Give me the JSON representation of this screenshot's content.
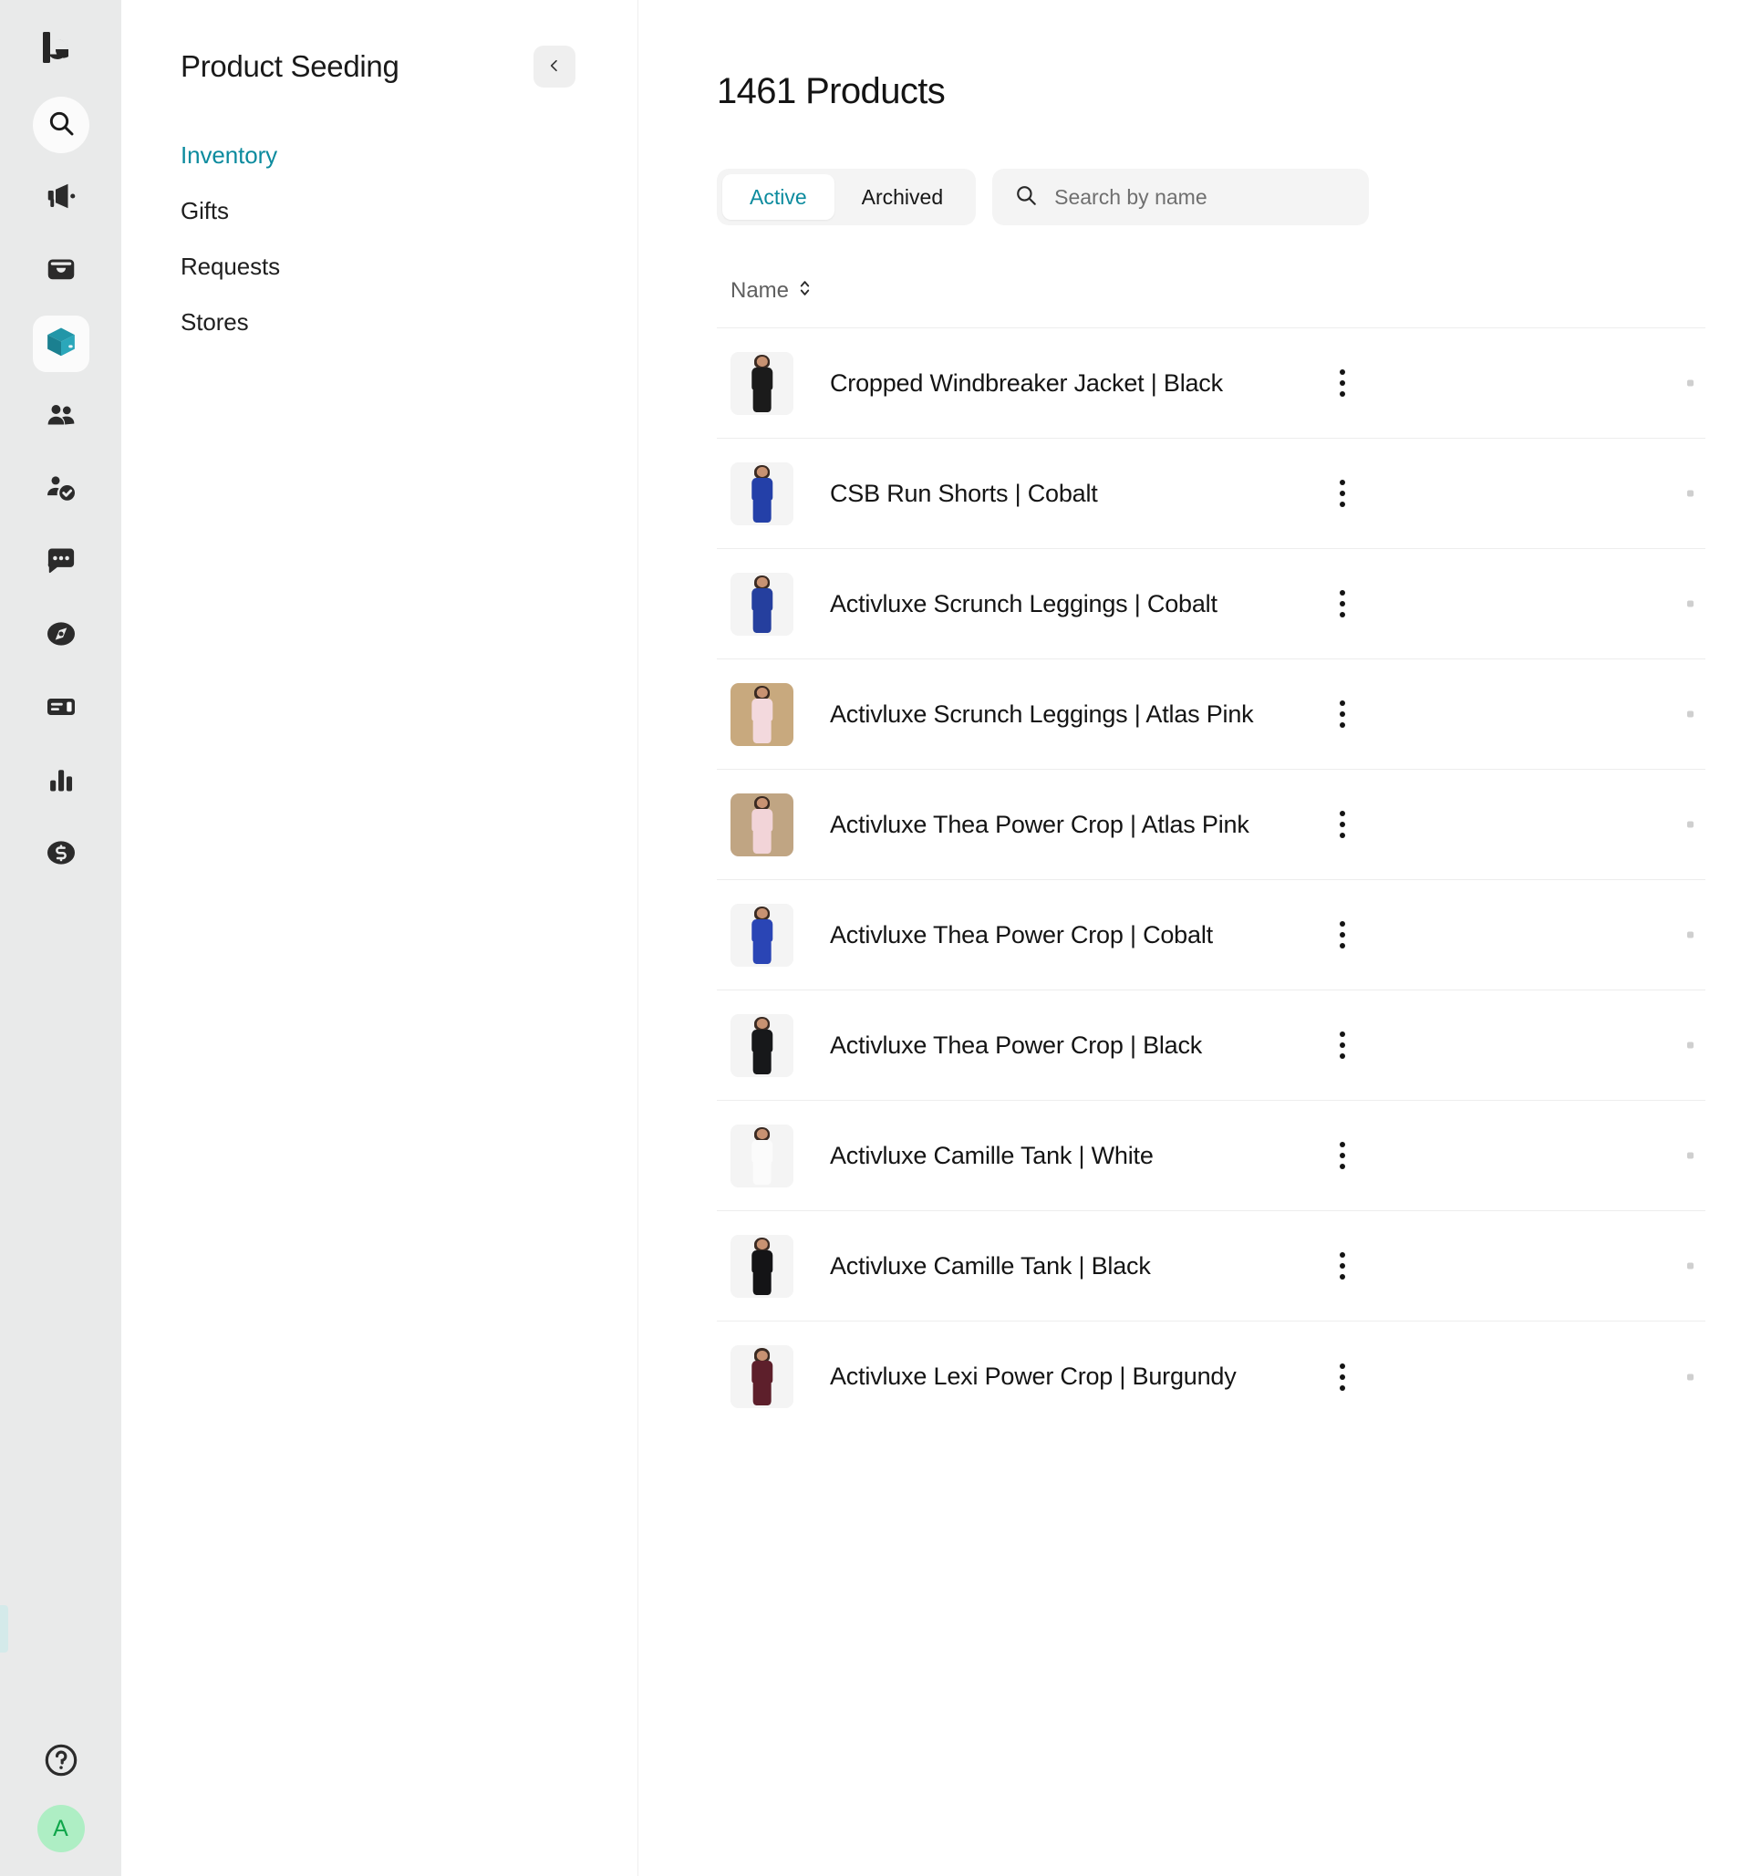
{
  "rail": {
    "logo": "brand-logo",
    "items": [
      {
        "icon": "search-icon",
        "name": "search",
        "style": "round"
      },
      {
        "icon": "megaphone-icon",
        "name": "campaigns",
        "style": "plain"
      },
      {
        "icon": "inbox-icon",
        "name": "inbox",
        "style": "plain"
      },
      {
        "icon": "box-3d-icon",
        "name": "product-seeding",
        "style": "active"
      },
      {
        "icon": "people-icon",
        "name": "creators",
        "style": "plain"
      },
      {
        "icon": "person-check-icon",
        "name": "approvals",
        "style": "plain"
      },
      {
        "icon": "chat-bubble-icon",
        "name": "messages",
        "style": "plain"
      },
      {
        "icon": "compass-icon",
        "name": "discover",
        "style": "plain"
      },
      {
        "icon": "card-icon",
        "name": "content",
        "style": "plain"
      },
      {
        "icon": "bar-chart-icon",
        "name": "reports",
        "style": "plain"
      },
      {
        "icon": "dollar-coin-icon",
        "name": "payments",
        "style": "plain"
      }
    ],
    "help_icon": "help-circle-icon",
    "avatar_initial": "A",
    "avatar_bg": "#aeeec4",
    "avatar_fg": "#0fa64a"
  },
  "panel": {
    "title": "Product Seeding",
    "collapse_icon": "chevron-left-icon",
    "nav": [
      {
        "label": "Inventory",
        "selected": true
      },
      {
        "label": "Gifts",
        "selected": false
      },
      {
        "label": "Requests",
        "selected": false
      },
      {
        "label": "Stores",
        "selected": false
      }
    ]
  },
  "main": {
    "title": "1461 Products",
    "tabs": [
      {
        "label": "Active",
        "active": true
      },
      {
        "label": "Archived",
        "active": false
      }
    ],
    "search": {
      "placeholder": "Search by name",
      "value": "",
      "icon": "search-icon"
    },
    "table": {
      "columns": [
        {
          "label": "Name",
          "sort_icon": "sort-updown-icon"
        }
      ],
      "rows": [
        {
          "name": "Cropped Windbreaker Jacket | Black",
          "garment": "#1b1b1b",
          "bg": "#f4f4f4",
          "menu_icon": "more-vertical-icon"
        },
        {
          "name": "CSB Run Shorts | Cobalt",
          "garment": "#2440a8",
          "bg": "#f4f4f4",
          "menu_icon": "more-vertical-icon"
        },
        {
          "name": "Activluxe Scrunch Leggings | Cobalt",
          "garment": "#253f9e",
          "bg": "#f4f4f4",
          "menu_icon": "more-vertical-icon"
        },
        {
          "name": "Activluxe Scrunch Leggings | Atlas Pink",
          "garment": "#f3d9dd",
          "bg": "#c8a97e",
          "menu_icon": "more-vertical-icon"
        },
        {
          "name": "Activluxe Thea Power Crop | Atlas Pink",
          "garment": "#f2d4d8",
          "bg": "#c0a583",
          "menu_icon": "more-vertical-icon"
        },
        {
          "name": "Activluxe Thea Power Crop | Cobalt",
          "garment": "#2a45b5",
          "bg": "#f4f4f4",
          "menu_icon": "more-vertical-icon"
        },
        {
          "name": "Activluxe Thea Power Crop | Black",
          "garment": "#17181a",
          "bg": "#f4f4f4",
          "menu_icon": "more-vertical-icon"
        },
        {
          "name": "Activluxe Camille Tank | White",
          "garment": "#fbfbfb",
          "bg": "#f4f4f4",
          "menu_icon": "more-vertical-icon"
        },
        {
          "name": "Activluxe Camille Tank | Black",
          "garment": "#141416",
          "bg": "#f4f4f4",
          "menu_icon": "more-vertical-icon"
        },
        {
          "name": "Activluxe Lexi Power Crop | Burgundy",
          "garment": "#5d1f2b",
          "bg": "#f4f4f4",
          "menu_icon": "more-vertical-icon"
        }
      ]
    }
  },
  "colors": {
    "accent": "#0c8b9e",
    "rail_bg": "#e9eaea",
    "divider": "#ededed",
    "text": "#141414",
    "muted": "#5f5f5f"
  }
}
